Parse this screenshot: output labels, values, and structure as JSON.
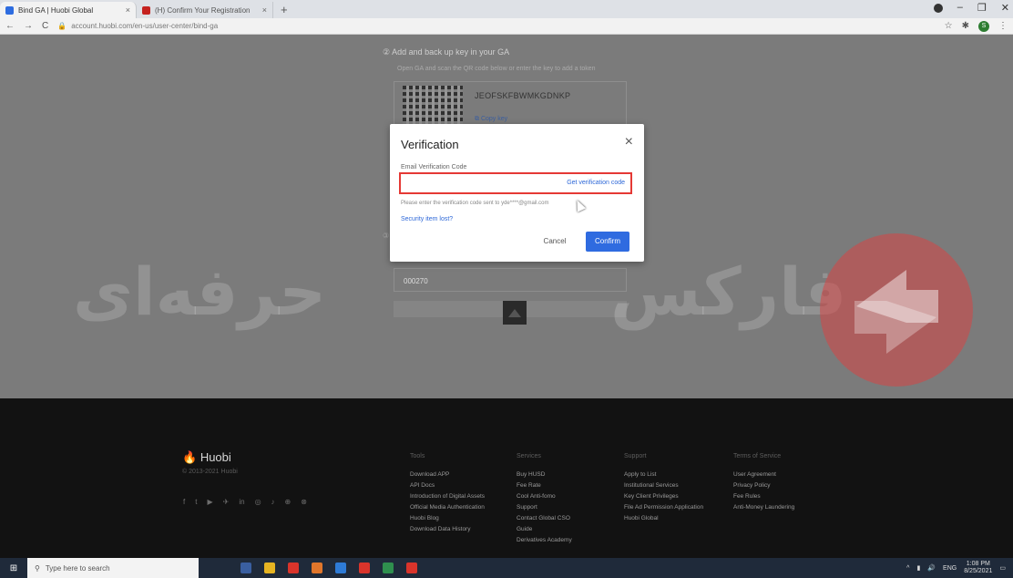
{
  "browser": {
    "tabs": [
      {
        "title": "Bind GA | Huobi Global",
        "active": true
      },
      {
        "title": "(H) Confirm Your Registration",
        "active": false
      }
    ],
    "new_tab": "+",
    "url": "account.huobi.com/en-us/user-center/bind-ga",
    "profile_initial": "S"
  },
  "page": {
    "step_title": "② Add and back up key in your GA",
    "step_subtitle": "Open GA and scan the QR code below or enter the key to add a token",
    "ga_key": "JEOFSKFBWMKGDNKP",
    "copy_key": "Copy key",
    "code_placeholder": "000270"
  },
  "watermark": {
    "text_left": "حرفه‌ای",
    "text_right": "فارکس"
  },
  "modal": {
    "title": "Verification",
    "close": "×",
    "field_label": "Email Verification Code",
    "input_value": "",
    "get_code": "Get verification code",
    "hint": "Please enter the verification code sent to yde****@gmail.com",
    "security_link": "Security item lost?",
    "cancel": "Cancel",
    "confirm": "Confirm"
  },
  "footer": {
    "brand": "Huobi",
    "copyright": "© 2013-2021 Huobi",
    "socials": [
      "f",
      "t",
      "▶",
      "✈",
      "in",
      "◎",
      "♪",
      "⊕",
      "⊗"
    ],
    "columns": [
      {
        "title": "Tools",
        "items": [
          "Download APP",
          "API Docs",
          "Introduction of Digital Assets",
          "Official Media Authentication",
          "Huobi Blog",
          "Download Data History"
        ]
      },
      {
        "title": "Services",
        "items": [
          "Buy HUSD",
          "Fee Rate",
          "Cool Anti-fomo",
          "Support",
          "Contact Global CSO",
          "Guide",
          "Derivatives Academy"
        ]
      },
      {
        "title": "Support",
        "items": [
          "Apply to List",
          "Institutional Services",
          "Key Client Privileges",
          "File Ad Permission Application",
          "Huobi Global"
        ]
      },
      {
        "title": "Terms of Service",
        "items": [
          "User Agreement",
          "Privacy Policy",
          "Fee Rules",
          "Anti-Money Laundering"
        ]
      }
    ]
  },
  "taskbar": {
    "search_placeholder": "Type here to search",
    "language": "ENG",
    "time": "1:08 PM",
    "date": "8/25/2021"
  },
  "colors": {
    "accent": "#2f6be0",
    "highlight_border": "#e53935",
    "footer_bg": "#121212"
  }
}
